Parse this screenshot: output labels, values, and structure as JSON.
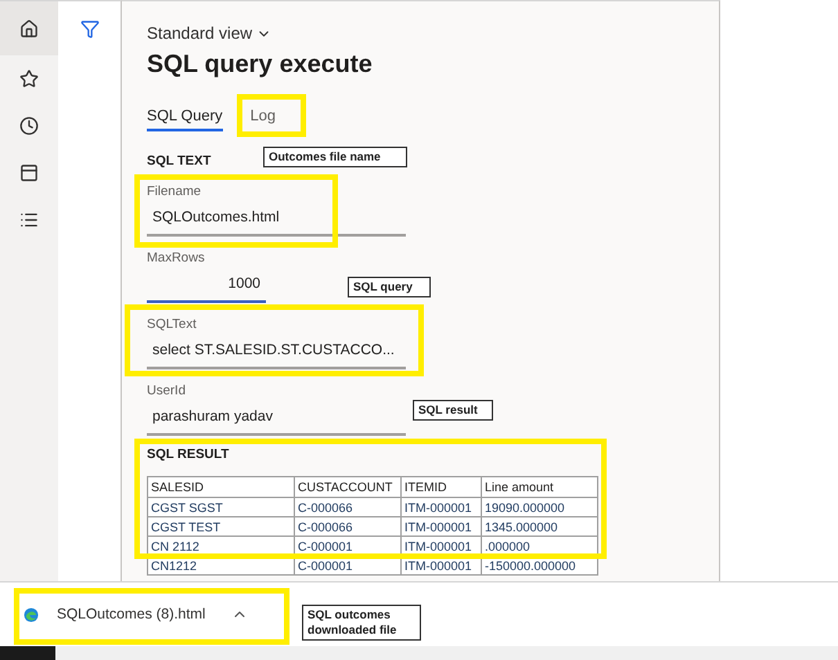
{
  "view_selector": "Standard view",
  "title": "SQL query execute",
  "tabs": [
    {
      "label": "SQL Query",
      "selected": true
    },
    {
      "label": "Log",
      "selected": false
    }
  ],
  "sql_text_section": {
    "heading": "SQL TEXT",
    "fields": [
      {
        "label": "Filename",
        "value": "SQLOutcomes.html",
        "kind": "text"
      },
      {
        "label": "MaxRows",
        "value": "1000",
        "kind": "number"
      },
      {
        "label": "SQLText",
        "value": "select ST.SALESID.ST.CUSTACCO...",
        "kind": "text"
      },
      {
        "label": "UserId",
        "value": "parashuram yadav",
        "kind": "text"
      }
    ]
  },
  "sql_result": {
    "heading": "SQL RESULT",
    "columns": [
      "SALESID",
      "CUSTACCOUNT",
      "ITEMID",
      "Line amount"
    ],
    "rows": [
      [
        "CGST SGST",
        "C-000066",
        "ITM-000001",
        "19090.000000"
      ],
      [
        "CGST TEST",
        "C-000066",
        "ITM-000001",
        "1345.000000"
      ],
      [
        "CN 2112",
        "C-000001",
        "ITM-000001",
        ".000000"
      ],
      [
        "CN1212",
        "C-000001",
        "ITM-000001",
        "-150000.000000"
      ]
    ]
  },
  "download_bar": {
    "file_name": "SQLOutcomes (8).html"
  },
  "annotations": [
    {
      "text": "Outcomes file name"
    },
    {
      "text": "SQL query"
    },
    {
      "text": "SQL result"
    },
    {
      "text": "SQL outcomes downloaded file"
    }
  ]
}
